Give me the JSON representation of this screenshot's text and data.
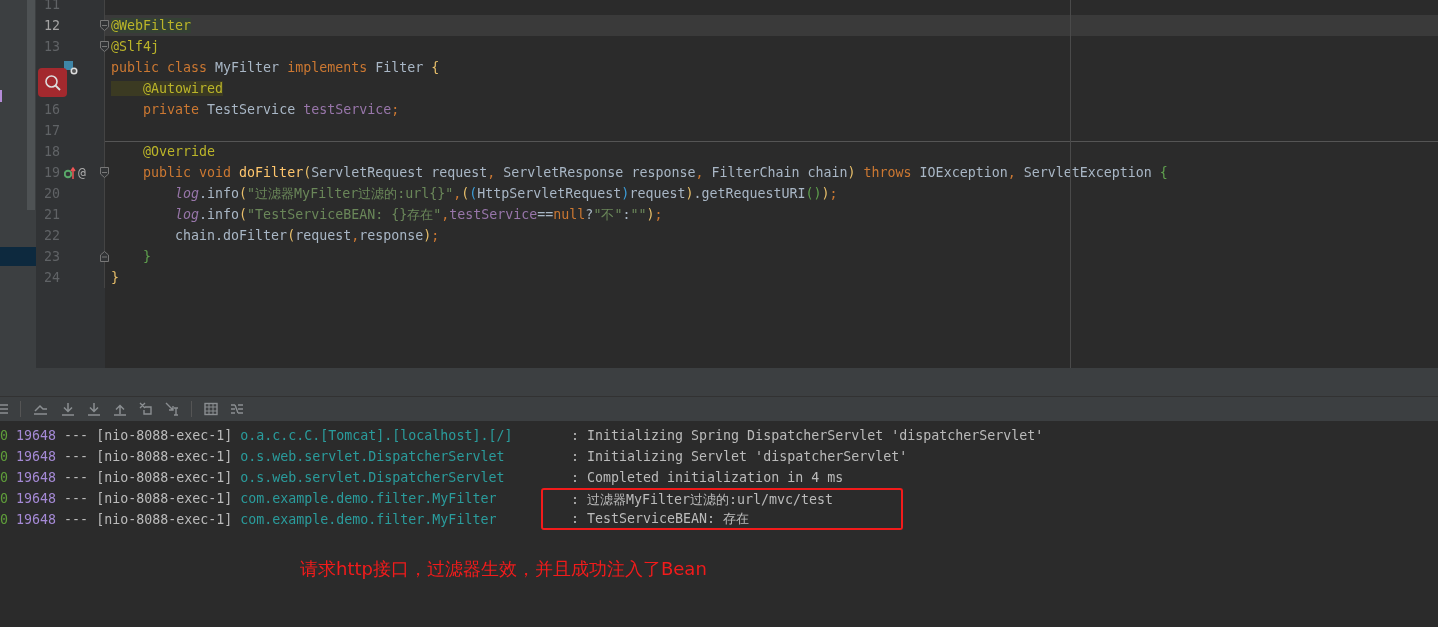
{
  "editor": {
    "lines": [
      {
        "number": "11",
        "current": false,
        "fold_start": false,
        "fold_end": false
      },
      {
        "number": "12",
        "current": true,
        "fold_start": true,
        "fold_end": false,
        "tokens": [
          {
            "kind": "ann_hl_green",
            "text": "@WebFilter"
          }
        ]
      },
      {
        "number": "13",
        "current": false,
        "fold_start": true,
        "fold_end": false,
        "tokens": [
          {
            "kind": "ann",
            "text": "@Slf4j"
          }
        ]
      },
      {
        "current": false,
        "fold_start": false,
        "fold_end": false,
        "gutter": [
          {
            "kind": "implemented"
          }
        ],
        "tokens": [
          {
            "kind": "kw",
            "text": "public class "
          },
          {
            "kind": "plain",
            "text": "MyFilter "
          },
          {
            "kind": "kw",
            "text": "implements "
          },
          {
            "kind": "plain",
            "text": "Filter "
          },
          {
            "kind": "bra",
            "text": "{"
          }
        ]
      },
      {
        "current": false,
        "fold_start": false,
        "fold_end": false,
        "tokens": [
          {
            "kind": "ann_hl_yellow",
            "text": "    @Autowired"
          }
        ]
      },
      {
        "number": "16",
        "current": false,
        "fold_start": false,
        "fold_end": false,
        "tokens": [
          {
            "kind": "kw",
            "text": "    private "
          },
          {
            "kind": "plain",
            "text": "TestService "
          },
          {
            "kind": "field",
            "text": "testService"
          },
          {
            "kind": "kw",
            "text": ";"
          }
        ]
      },
      {
        "number": "17",
        "current": false,
        "fold_start": false,
        "fold_end": false
      },
      {
        "number": "18",
        "current": false,
        "fold_start": false,
        "fold_end": false,
        "separator": true,
        "tokens": [
          {
            "kind": "ann",
            "text": "    @Override"
          }
        ]
      },
      {
        "number": "19",
        "current": false,
        "fold_start": true,
        "fold_end": false,
        "gutter": [
          {
            "kind": "override"
          },
          {
            "kind": "symbol",
            "text": "@"
          }
        ],
        "tokens": [
          {
            "kind": "kw",
            "text": "    public void "
          },
          {
            "kind": "decl",
            "text": "doFilter"
          },
          {
            "kind": "bra",
            "text": "("
          },
          {
            "kind": "plain",
            "text": "ServletRequest request"
          },
          {
            "kind": "kw",
            "text": ", "
          },
          {
            "kind": "plain",
            "text": "ServletResponse response"
          },
          {
            "kind": "kw",
            "text": ", "
          },
          {
            "kind": "plain",
            "text": "FilterChain chain"
          },
          {
            "kind": "bra",
            "text": ")"
          },
          {
            "kind": "kw",
            "text": " throws "
          },
          {
            "kind": "plain",
            "text": "IOException"
          },
          {
            "kind": "kw",
            "text": ", "
          },
          {
            "kind": "plain",
            "text": "ServletException "
          },
          {
            "kind": "brc",
            "text": "{"
          }
        ]
      },
      {
        "number": "20",
        "current": false,
        "fold_start": false,
        "fold_end": false,
        "tokens": [
          {
            "kind": "static",
            "text": "        log"
          },
          {
            "kind": "plain",
            "text": ".info"
          },
          {
            "kind": "bra",
            "text": "("
          },
          {
            "kind": "str",
            "text": "\"过滤器MyFilter过滤的:url{}\""
          },
          {
            "kind": "kw",
            "text": ","
          },
          {
            "kind": "bra",
            "text": "("
          },
          {
            "kind": "brb",
            "text": "("
          },
          {
            "kind": "plain",
            "text": "HttpServletRequest"
          },
          {
            "kind": "brb",
            "text": ")"
          },
          {
            "kind": "plain",
            "text": "request"
          },
          {
            "kind": "bra",
            "text": ")"
          },
          {
            "kind": "plain",
            "text": ".getRequestURI"
          },
          {
            "kind": "brc",
            "text": "()"
          },
          {
            "kind": "bra",
            "text": ")"
          },
          {
            "kind": "kw",
            "text": ";"
          }
        ]
      },
      {
        "number": "21",
        "current": false,
        "fold_start": false,
        "fold_end": false,
        "tokens": [
          {
            "kind": "static",
            "text": "        log"
          },
          {
            "kind": "plain",
            "text": ".info"
          },
          {
            "kind": "bra",
            "text": "("
          },
          {
            "kind": "str",
            "text": "\"TestServiceBEAN: {}存在\""
          },
          {
            "kind": "kw",
            "text": ","
          },
          {
            "kind": "field",
            "text": "testService"
          },
          {
            "kind": "plain",
            "text": "=="
          },
          {
            "kind": "kw",
            "text": "null"
          },
          {
            "kind": "plain",
            "text": "?"
          },
          {
            "kind": "str",
            "text": "\"不\""
          },
          {
            "kind": "plain",
            "text": ":"
          },
          {
            "kind": "str",
            "text": "\"\""
          },
          {
            "kind": "bra",
            "text": ")"
          },
          {
            "kind": "kw",
            "text": ";"
          }
        ]
      },
      {
        "number": "22",
        "current": false,
        "fold_start": false,
        "fold_end": false,
        "tokens": [
          {
            "kind": "plain",
            "text": "        chain.doFilter"
          },
          {
            "kind": "bra",
            "text": "("
          },
          {
            "kind": "plain",
            "text": "request"
          },
          {
            "kind": "kw",
            "text": ","
          },
          {
            "kind": "plain",
            "text": "response"
          },
          {
            "kind": "bra",
            "text": ")"
          },
          {
            "kind": "kw",
            "text": ";"
          }
        ]
      },
      {
        "number": "23",
        "current": false,
        "fold_start": false,
        "fold_end": true,
        "tokens": [
          {
            "kind": "brc",
            "text": "    }"
          }
        ]
      },
      {
        "number": "24",
        "current": false,
        "fold_start": false,
        "fold_end": false,
        "tokens": [
          {
            "kind": "bra",
            "text": "}"
          }
        ]
      }
    ]
  },
  "console": {
    "rows": [
      {
        "level": "0",
        "pid": "19648",
        "sep": "---",
        "thread": "[nio-8088-exec-1]",
        "logger": "o.a.c.c.C.[Tomcat].[localhost].[/]",
        "message": ": Initializing Spring DispatcherServlet 'dispatcherServlet'",
        "boxed": false
      },
      {
        "level": "0",
        "pid": "19648",
        "sep": "---",
        "thread": "[nio-8088-exec-1]",
        "logger": "o.s.web.servlet.DispatcherServlet",
        "message": ": Initializing Servlet 'dispatcherServlet'",
        "boxed": false
      },
      {
        "level": "0",
        "pid": "19648",
        "sep": "---",
        "thread": "[nio-8088-exec-1]",
        "logger": "o.s.web.servlet.DispatcherServlet",
        "message": ": Completed initialization in 4 ms",
        "boxed": false
      },
      {
        "level": "0",
        "pid": "19648",
        "sep": "---",
        "thread": "[nio-8088-exec-1]",
        "logger": "com.example.demo.filter.MyFilter",
        "message": ": 过滤器MyFilter过滤的:url/mvc/test",
        "boxed": true
      },
      {
        "level": "0",
        "pid": "19648",
        "sep": "---",
        "thread": "[nio-8088-exec-1]",
        "logger": "com.example.demo.filter.MyFilter",
        "message": ": TestServiceBEAN: 存在",
        "boxed": true
      }
    ],
    "annotation": "请求http接口，过滤器生效，并且成功注入了Bean"
  }
}
